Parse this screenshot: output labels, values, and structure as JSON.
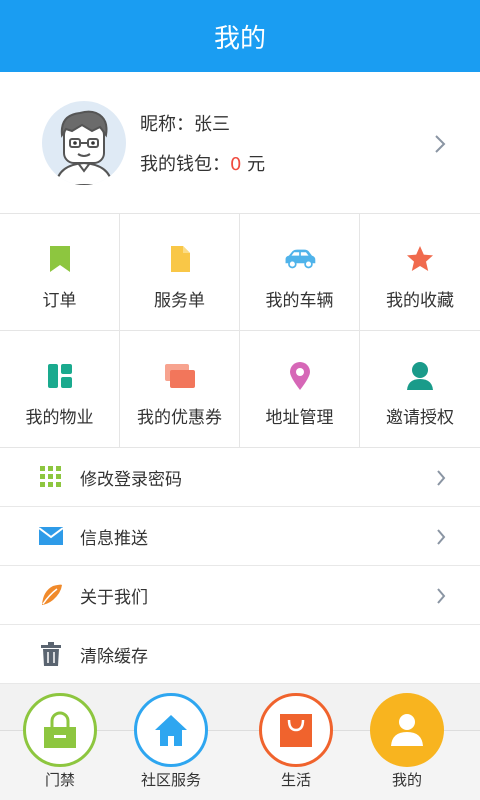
{
  "header": {
    "title": "我的"
  },
  "profile": {
    "nickname": "昵称：张三",
    "wallet_label": "我的钱包：",
    "wallet_amount": "0",
    "wallet_unit": " 元"
  },
  "grid": [
    {
      "label": "订单",
      "icon": "bookmark-icon",
      "color": "#8dc63f"
    },
    {
      "label": "服务单",
      "icon": "document-icon",
      "color": "#f9c747"
    },
    {
      "label": "我的车辆",
      "icon": "car-icon",
      "color": "#4fb3ea"
    },
    {
      "label": "我的收藏",
      "icon": "star-icon",
      "color": "#f06a4d"
    },
    {
      "label": "我的物业",
      "icon": "layout-icon",
      "color": "#1aaa8e"
    },
    {
      "label": "我的优惠券",
      "icon": "coupon-icon",
      "color": "#f2765b"
    },
    {
      "label": "地址管理",
      "icon": "location-pin-icon",
      "color": "#d667b7"
    },
    {
      "label": "邀请授权",
      "icon": "person-icon",
      "color": "#1a9b8a"
    }
  ],
  "list": [
    {
      "label": "修改登录密码",
      "icon": "grid-dots-icon",
      "color": "#8dc63f"
    },
    {
      "label": "信息推送",
      "icon": "envelope-icon",
      "color": "#2e9be8"
    },
    {
      "label": "关于我们",
      "icon": "leaf-icon",
      "color": "#f08a2b"
    },
    {
      "label": "清除缓存",
      "icon": "trash-icon",
      "color": "#5a6470"
    }
  ],
  "tabs": [
    {
      "label": "门禁",
      "icon": "lock-icon",
      "color": "#8dc63f"
    },
    {
      "label": "社区服务",
      "icon": "home-icon",
      "color": "#2ea6f0"
    },
    {
      "label": "生活",
      "icon": "shopping-bag-icon",
      "color": "#f0632d"
    },
    {
      "label": "我的",
      "icon": "user-icon",
      "color": "#f8b41f"
    }
  ]
}
